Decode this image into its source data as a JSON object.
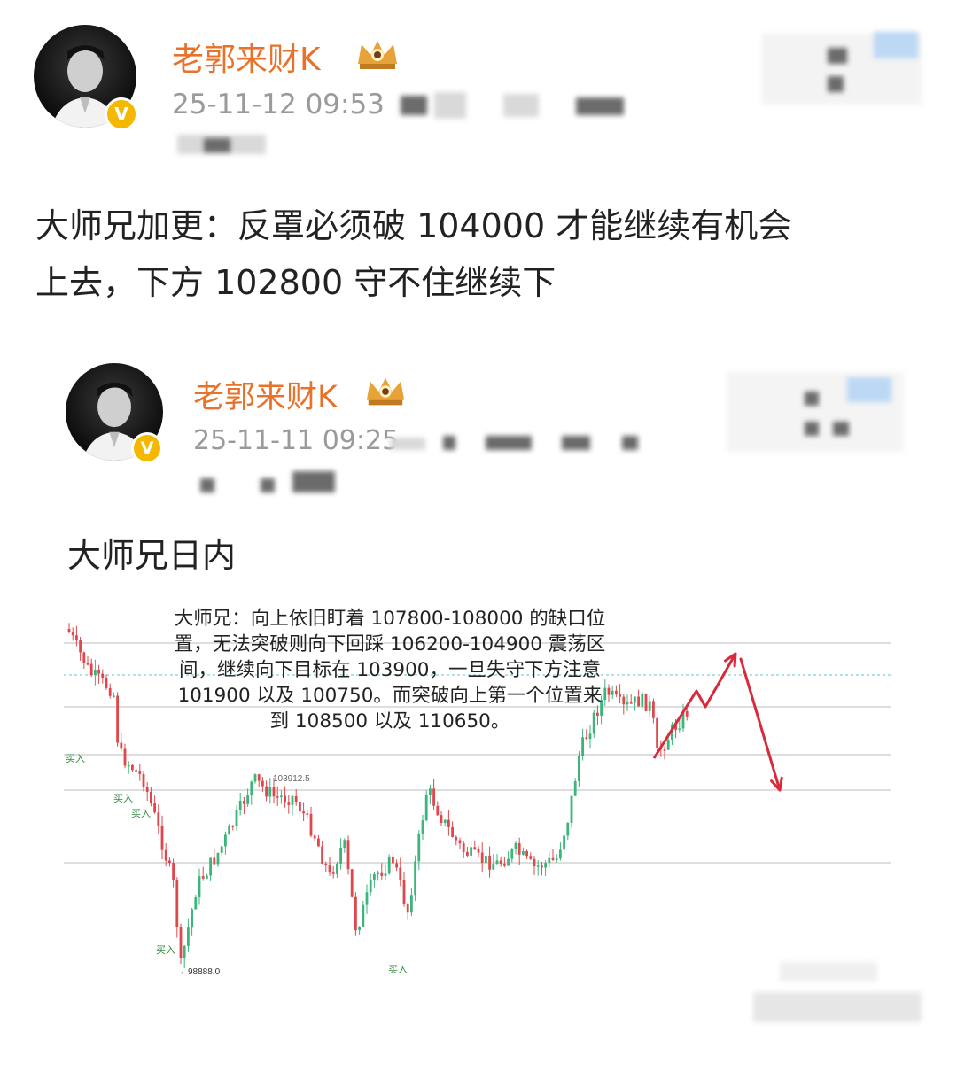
{
  "post": {
    "author": "老郭来财K",
    "timestamp": "25-11-12 09:53",
    "text_line1": "大师兄加更：反罩必须破 104000 才能继续有机会",
    "text_line2": "上去，下方 102800 守不住继续下"
  },
  "repost": {
    "author": "老郭来财K",
    "timestamp": "25-11-11 09:25",
    "title": "大师兄日内",
    "annotation_lines": [
      "大师兄：向上依旧盯着 107800-108000 的缺口位",
      "置，无法突破则向下回踩 106200-104900 震荡区",
      "间，继续向下目标在 103900，一旦失守下方注意",
      "101900 以及 100750。而突破向上第一个位置来",
      "到 108500 以及 110650。"
    ]
  },
  "icons": {
    "verified": "verified-badge-icon",
    "crown": "crown-icon"
  },
  "colors": {
    "username": "#e8722a",
    "verified": "#f5b800",
    "candle_up": "#3bb57a",
    "candle_down": "#e0474c",
    "arrow": "#d82a3a"
  },
  "chart_data": {
    "type": "candlestick",
    "labels": {
      "high_marker": "103912.5",
      "low_marker": "98888.0",
      "buy_label": "买入"
    },
    "buy_signals": 5
  }
}
